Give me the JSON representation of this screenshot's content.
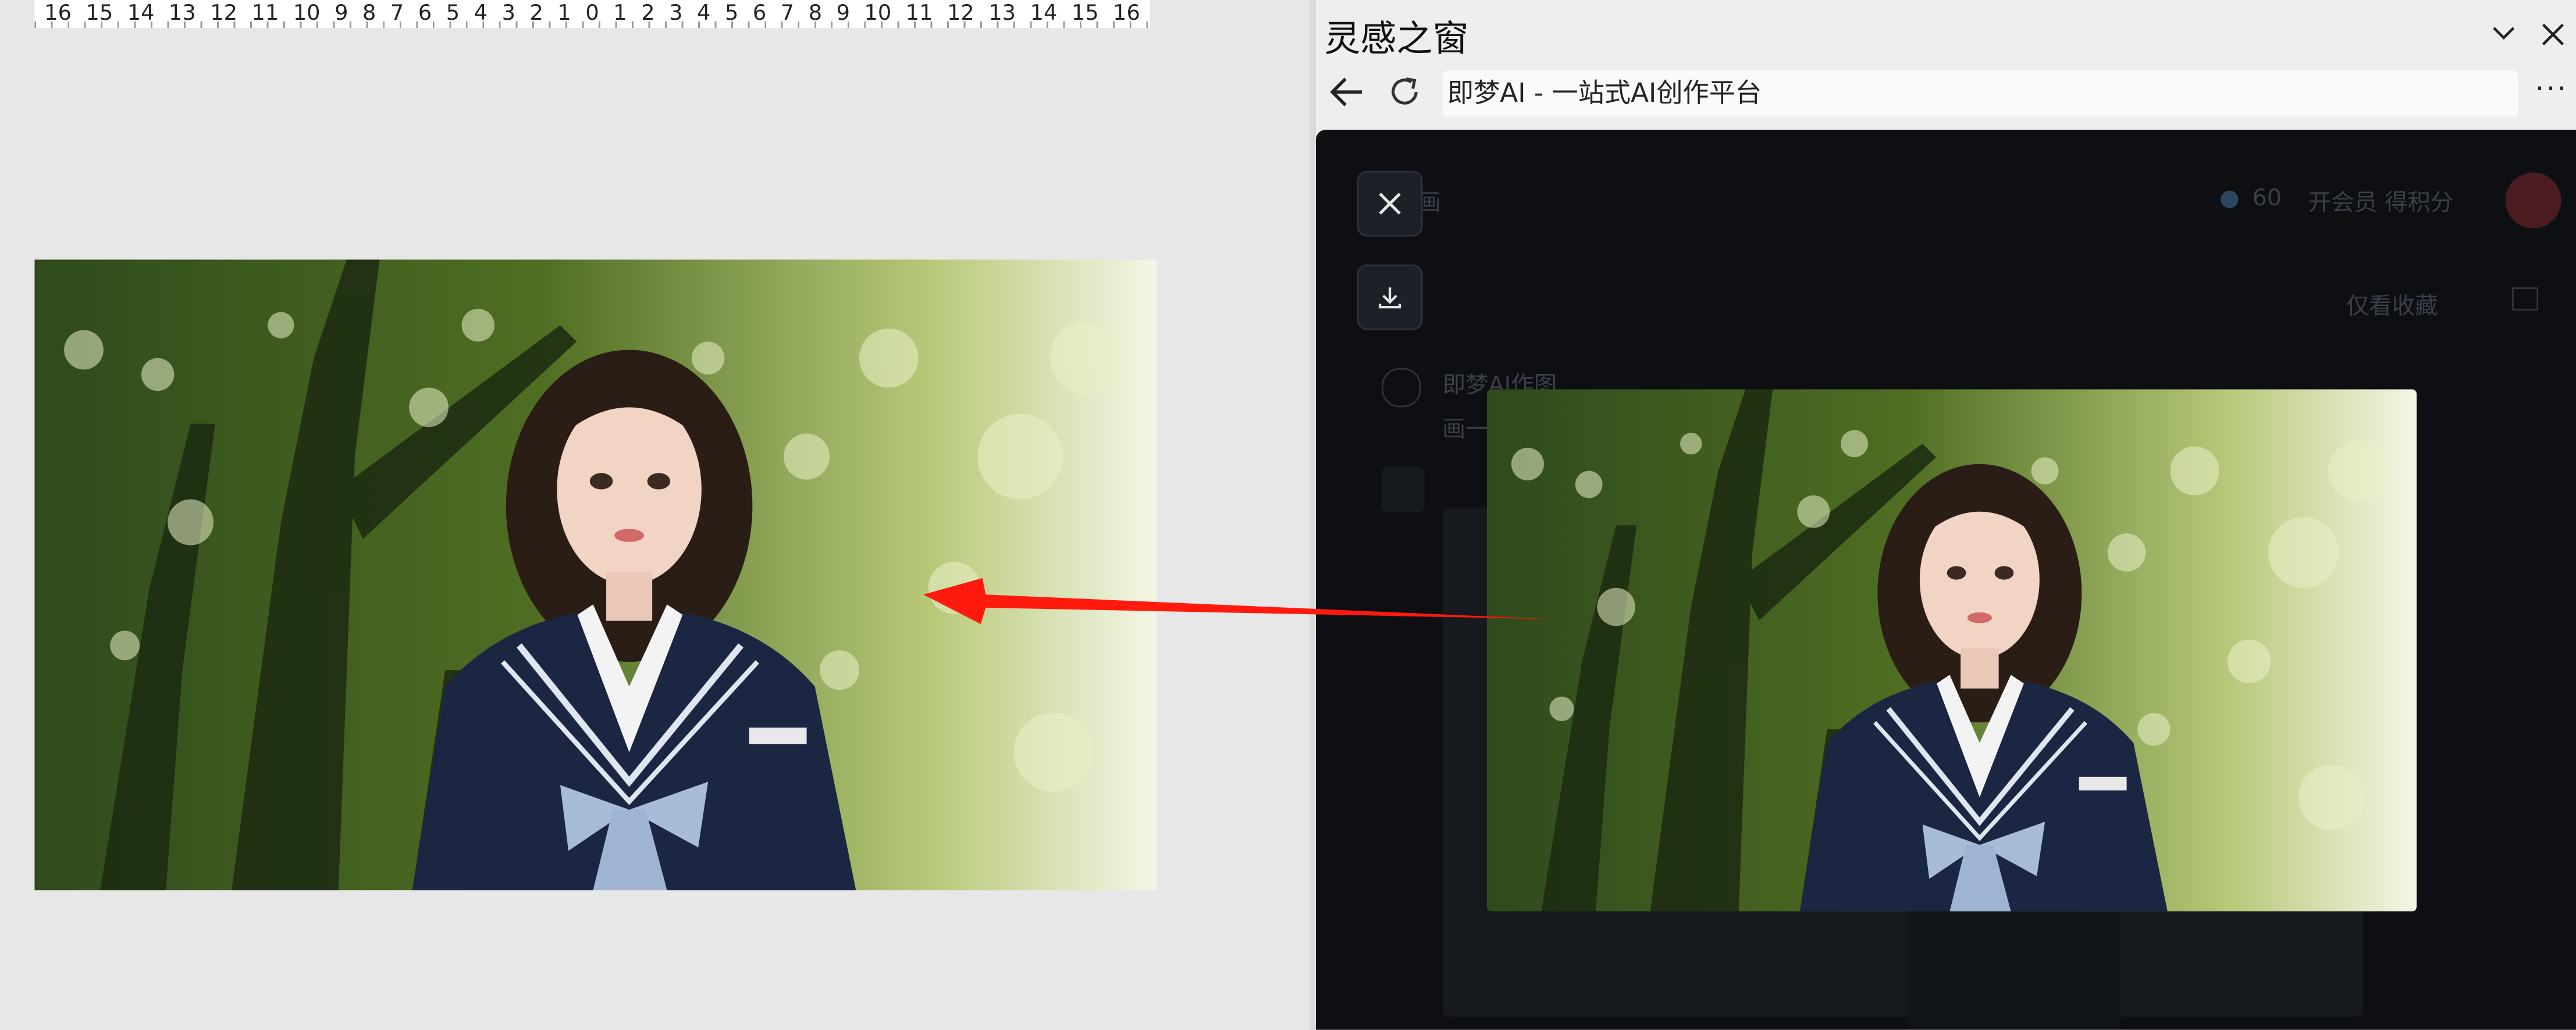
{
  "ruler": {
    "ticks": [
      "16",
      "15",
      "14",
      "13",
      "12",
      "11",
      "10",
      "9",
      "8",
      "7",
      "6",
      "5",
      "4",
      "3",
      "2",
      "1",
      "0",
      "1",
      "2",
      "3",
      "4",
      "5",
      "6",
      "7",
      "8",
      "9",
      "10",
      "11",
      "12",
      "13",
      "14",
      "15",
      "16"
    ]
  },
  "panel": {
    "title": "灵感之窗",
    "collapse_icon": "chevron-down-icon",
    "close_icon": "close-icon",
    "url": "即梦AI - 一站式AI创作平台",
    "more_label": "···"
  },
  "web": {
    "behind_text_1": "画",
    "behind_credits": "60",
    "behind_member": "开会员 得积分",
    "behind_collect": "仅看收藏",
    "behind_author": "即梦AI作图",
    "behind_line": "画一",
    "close_icon": "close-icon",
    "download_icon": "download-icon"
  },
  "colors": {
    "arrow": "#ff1a0d",
    "dark_bg": "#0d0f13",
    "uniform": "#1b2742"
  }
}
